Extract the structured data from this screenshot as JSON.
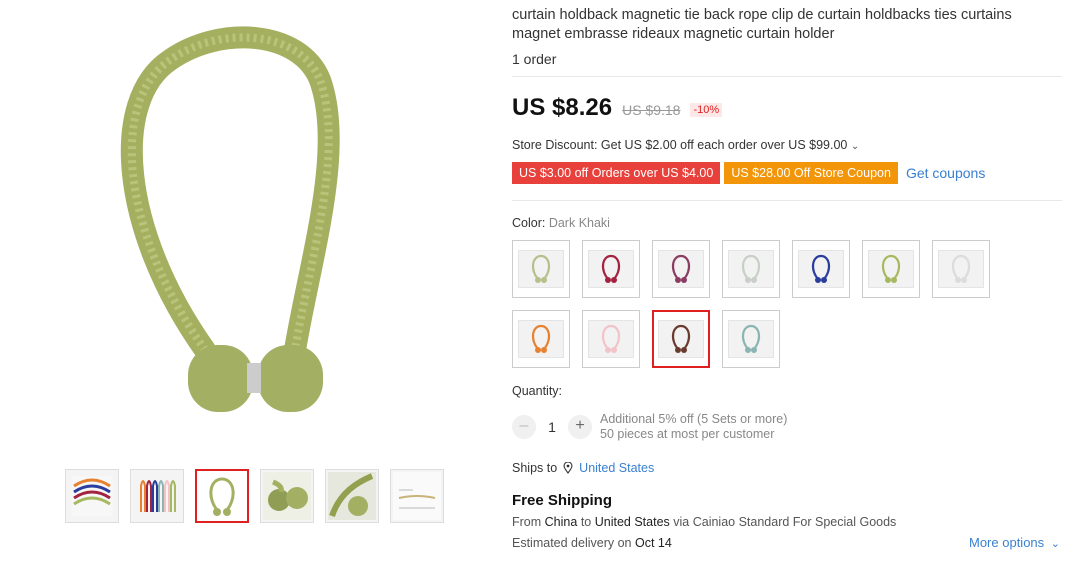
{
  "product": {
    "title": "curtain holdback magnetic tie back rope clip de curtain holdbacks ties curtains magnet embrasse rideaux magnetic curtain holder",
    "orders": "1 order",
    "price": "US $8.26",
    "old_price": "US $9.18",
    "discount": "-10%",
    "store_discount": "Store Discount: Get US $2.00 off each order over US $99.00",
    "coupons": [
      "US $3.00 off Orders over US $4.00",
      "US $28.00 Off Store Coupon"
    ],
    "get_coupons": "Get coupons",
    "color_label": "Color:",
    "color_value": "Dark Khaki",
    "swatch_colors": [
      "#b7bf8a",
      "#a3223f",
      "#8a3c62",
      "#c8cfc7",
      "#2a3d9c",
      "#a6b860",
      "#dcdcdc",
      "#e8812f",
      "#f2c3c8",
      "#6b3a2f",
      "#8bb5b0"
    ],
    "selected_swatch": 9,
    "quantity_label": "Quantity:",
    "quantity": "1",
    "qty_note_1": "Additional 5% off (5 Sets or more)",
    "qty_note_2": "50 pieces at most per customer",
    "ships_to_label": "Ships to",
    "ships_to": "United States",
    "free_shipping": "Free Shipping",
    "from_prefix": "From",
    "from_country": "China",
    "to_word": "to",
    "to_country": "United States",
    "via": "via Cainiao Standard For Special Goods",
    "estimated": "Estimated delivery on",
    "est_date": "Oct 14",
    "more_options": "More options",
    "main_color": "#9aa85a"
  }
}
